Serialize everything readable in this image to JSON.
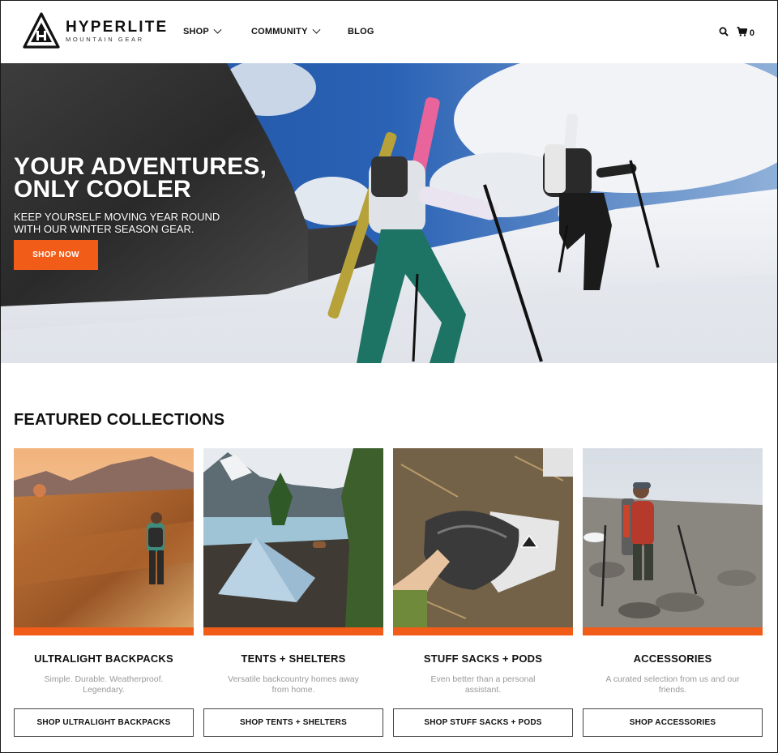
{
  "brand": {
    "name": "HYPERLITE",
    "tagline": "MOUNTAIN GEAR"
  },
  "nav": {
    "shop": "SHOP",
    "community": "COMMUNITY",
    "blog": "BLOG"
  },
  "header": {
    "cart_count": "0",
    "search_icon": "search-icon",
    "cart_icon": "cart-icon"
  },
  "hero": {
    "title_line1": "YOUR ADVENTURES,",
    "title_line2": "ONLY COOLER",
    "subtitle_line1": "KEEP YOURSELF MOVING YEAR ROUND",
    "subtitle_line2": "WITH OUR WINTER SEASON GEAR.",
    "cta": "SHOP NOW"
  },
  "featured": {
    "title": "FEATURED COLLECTIONS",
    "cards": [
      {
        "title": "ULTRALIGHT BACKPACKS",
        "desc": "Simple. Durable. Weatherproof. Legendary.",
        "button": "SHOP ULTRALIGHT BACKPACKS"
      },
      {
        "title": "TENTS + SHELTERS",
        "desc": "Versatile backcountry homes away from home.",
        "button": "SHOP TENTS + SHELTERS"
      },
      {
        "title": "STUFF SACKS + PODS",
        "desc": "Even better than a personal assistant.",
        "button": "SHOP STUFF SACKS + PODS"
      },
      {
        "title": "ACCESSORIES",
        "desc": "A curated selection from us and our friends.",
        "button": "SHOP ACCESSORIES"
      }
    ]
  },
  "colors": {
    "accent": "#f25c19",
    "text": "#111111",
    "muted": "#999999"
  }
}
